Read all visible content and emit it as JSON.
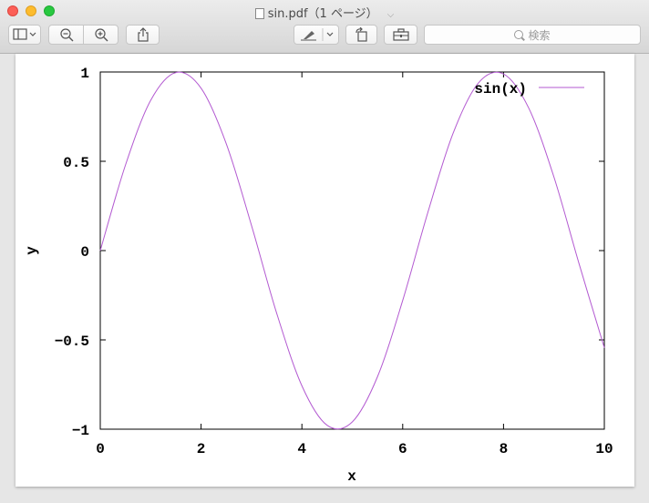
{
  "window": {
    "title": "sin.pdf（1 ページ）",
    "title_chevron": "⌵"
  },
  "toolbar": {
    "sidebar_icon": "sidebar-icon",
    "zoom_out_icon": "zoom-out-icon",
    "zoom_in_icon": "zoom-in-icon",
    "share_icon": "share-icon",
    "markup_icon": "pen-icon",
    "rotate_icon": "rotate-icon",
    "toolbox_icon": "toolbox-icon",
    "search_placeholder": "検索"
  },
  "colors": {
    "series": "#b35ad1",
    "close": "#fc5f57",
    "minimize": "#fdbc2e",
    "maximize": "#28c840"
  },
  "chart_data": {
    "type": "line",
    "function": "sin(x)",
    "title": "",
    "xlabel": "x",
    "ylabel": "y",
    "xlim": [
      0,
      10
    ],
    "ylim": [
      -1,
      1
    ],
    "x_ticks": [
      "0",
      "2",
      "4",
      "6",
      "8",
      "10"
    ],
    "y_ticks": [
      "1",
      "0.5",
      "0",
      "−0.5",
      "−1"
    ],
    "legend_position": "top-right",
    "grid": false,
    "series": [
      {
        "name": "sin(x)",
        "x": [
          0,
          0.5,
          1,
          1.5,
          2,
          2.5,
          3,
          3.5,
          4,
          4.5,
          5,
          5.5,
          6,
          6.5,
          7,
          7.5,
          8,
          8.5,
          9,
          9.5,
          10
        ],
        "y": [
          0,
          0.479,
          0.841,
          0.997,
          0.909,
          0.598,
          0.141,
          -0.351,
          -0.757,
          -0.978,
          -0.959,
          -0.706,
          -0.279,
          0.215,
          0.657,
          0.938,
          0.989,
          0.798,
          0.412,
          -0.075,
          -0.544
        ]
      }
    ]
  }
}
